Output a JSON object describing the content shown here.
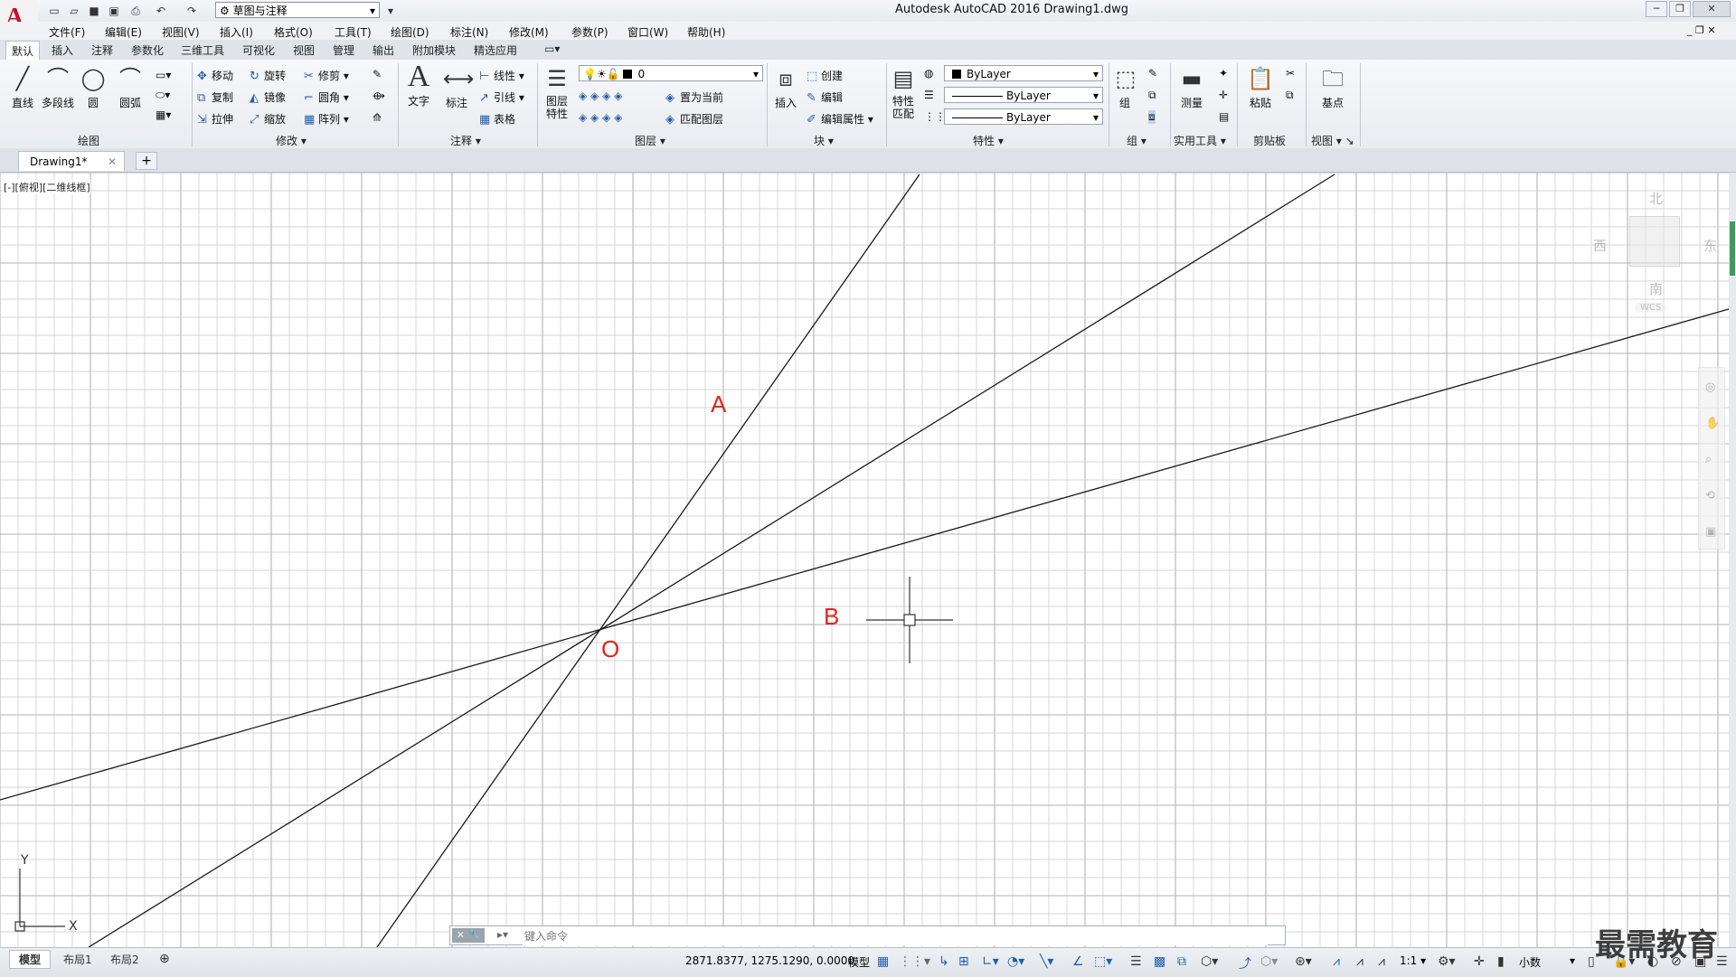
{
  "window": {
    "title": "Autodesk AutoCAD 2016    Drawing1.dwg",
    "workspace": "草图与注释"
  },
  "menu": [
    "文件(F)",
    "编辑(E)",
    "视图(V)",
    "插入(I)",
    "格式(O)",
    "工具(T)",
    "绘图(D)",
    "标注(N)",
    "修改(M)",
    "参数(P)",
    "窗口(W)",
    "帮助(H)"
  ],
  "ribbon_tabs": [
    "默认",
    "插入",
    "注释",
    "参数化",
    "三维工具",
    "可视化",
    "视图",
    "管理",
    "输出",
    "附加模块",
    "精选应用"
  ],
  "panels": {
    "draw": {
      "title": "绘图",
      "line": "直线",
      "polyline": "多段线",
      "circle": "圆",
      "arc": "圆弧"
    },
    "modify": {
      "title": "修改",
      "move": "移动",
      "rotate": "旋转",
      "trim": "修剪",
      "copy": "复制",
      "mirror": "镜像",
      "fillet": "圆角",
      "stretch": "拉伸",
      "scale": "缩放",
      "array": "阵列"
    },
    "annotation": {
      "title": "注释",
      "text": "文字",
      "dimension": "标注",
      "linear": "线性",
      "leader": "引线",
      "table": "表格"
    },
    "layers": {
      "title": "图层",
      "layer_props": "图层\n特性",
      "current_layer": "0",
      "set_current": "置为当前",
      "match_layer": "匹配图层"
    },
    "block": {
      "title": "块",
      "insert": "插入",
      "create": "创建",
      "edit": "编辑",
      "edit_attr": "编辑属性"
    },
    "properties": {
      "title": "特性",
      "match": "特性\n匹配",
      "color": "ByLayer",
      "linetype": "ByLayer",
      "lineweight": "ByLayer"
    },
    "groups": {
      "title": "组",
      "group": "组"
    },
    "utilities": {
      "title": "实用工具",
      "measure": "测量"
    },
    "clipboard": {
      "title": "剪贴板",
      "paste": "粘贴"
    },
    "view": {
      "title": "视图",
      "base": "基点"
    }
  },
  "file_tab": "Drawing1*",
  "viewport_label": "[-][俯视][二维线框]",
  "viewcube": {
    "north": "北",
    "south": "南",
    "east": "东",
    "west": "西",
    "wcs": "WCS"
  },
  "labels": {
    "a": "A",
    "b": "B",
    "o": "O"
  },
  "ucs": {
    "x": "X",
    "y": "Y"
  },
  "command": {
    "placeholder": "键入命令"
  },
  "layout_tabs": [
    "模型",
    "布局1",
    "布局2"
  ],
  "status": {
    "coords": "2871.8377, 1275.1290, 0.0000",
    "model": "模型",
    "scale": "1:1",
    "units": "小数"
  },
  "watermark": "最需教育",
  "colors": {
    "label_red": "#e8231f",
    "grid": "#c9c9c9",
    "line": "#1a1a1a"
  }
}
